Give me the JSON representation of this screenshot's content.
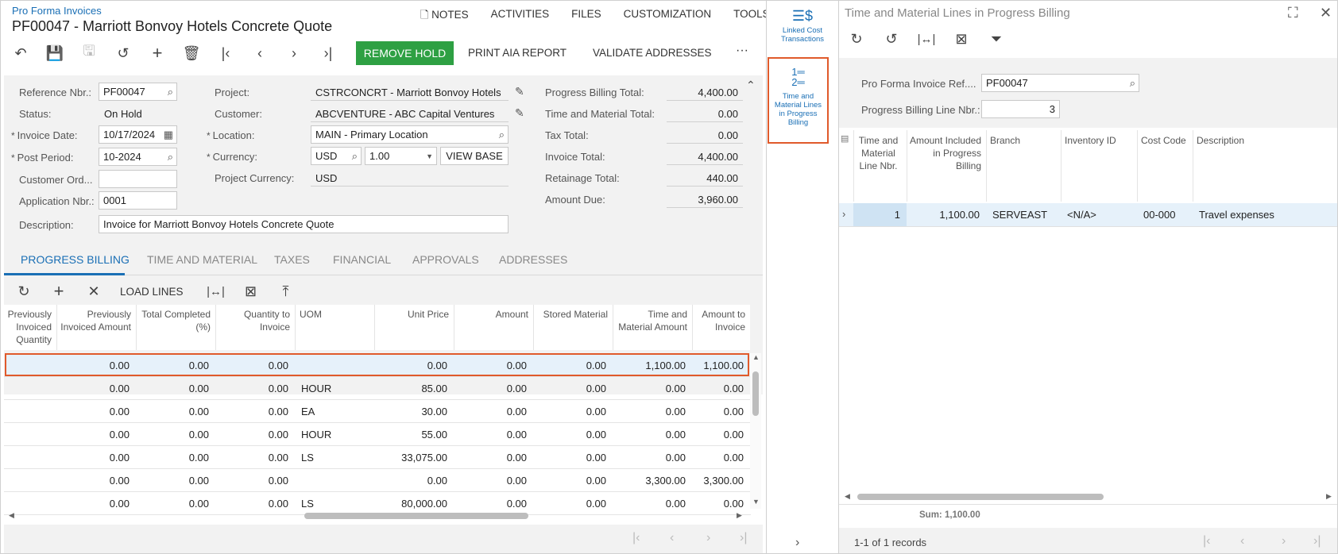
{
  "header": {
    "breadcrumb": "Pro Forma Invoices",
    "title": "PF00047 - Marriott Bonvoy Hotels Concrete Quote"
  },
  "top_menu": [
    "NOTES",
    "ACTIVITIES",
    "FILES",
    "CUSTOMIZATION",
    "TOOLS"
  ],
  "toolbar": {
    "remove_hold": "REMOVE HOLD",
    "print_aia": "PRINT AIA REPORT",
    "validate": "VALIDATE ADDRESSES",
    "more": "···"
  },
  "form": {
    "ref_label": "Reference Nbr.:",
    "ref_value": "PF00047",
    "status_label": "Status:",
    "status_value": "On Hold",
    "invdate_label": "Invoice Date:",
    "invdate_value": "10/17/2024",
    "postper_label": "Post Period:",
    "postper_value": "10-2024",
    "custord_label": "Customer Ord...",
    "custord_value": "",
    "appnbr_label": "Application Nbr.:",
    "appnbr_value": "0001",
    "desc_label": "Description:",
    "desc_value": "Invoice for Marriott Bonvoy Hotels Concrete Quote",
    "project_label": "Project:",
    "project_value": "CSTRCONCRT - Marriott Bonvoy Hotels",
    "customer_label": "Customer:",
    "customer_value": "ABCVENTURE - ABC Capital Ventures",
    "location_label": "Location:",
    "location_value": "MAIN - Primary Location",
    "currency_label": "Currency:",
    "currency_value": "USD",
    "rate_value": "1.00",
    "view_base": "VIEW BASE",
    "projcur_label": "Project Currency:",
    "projcur_value": "USD"
  },
  "totals": [
    {
      "label": "Progress Billing Total:",
      "value": "4,400.00"
    },
    {
      "label": "Time and Material Total:",
      "value": "0.00"
    },
    {
      "label": "Tax Total:",
      "value": "0.00"
    },
    {
      "label": "Invoice Total:",
      "value": "4,400.00"
    },
    {
      "label": "Retainage Total:",
      "value": "440.00"
    },
    {
      "label": "Amount Due:",
      "value": "3,960.00"
    }
  ],
  "tabs": [
    "PROGRESS BILLING",
    "TIME AND MATERIAL",
    "TAXES",
    "FINANCIAL",
    "APPROVALS",
    "ADDRESSES"
  ],
  "grid": {
    "load_lines": "LOAD LINES",
    "columns": [
      "Previously Invoiced Quantity",
      "Previously Invoiced Amount",
      "Total Completed (%)",
      "Quantity to Invoice",
      "UOM",
      "Unit Price",
      "Amount",
      "Stored Material",
      "Time and Material Amount",
      "Amount to Invoice"
    ],
    "rows": [
      [
        "",
        "0.00",
        "0.00",
        "0.00",
        "",
        "0.00",
        "0.00",
        "0.00",
        "1,100.00",
        "1,100.00"
      ],
      [
        "",
        "0.00",
        "0.00",
        "0.00",
        "HOUR",
        "85.00",
        "0.00",
        "0.00",
        "0.00",
        "0.00"
      ],
      [
        "",
        "0.00",
        "0.00",
        "0.00",
        "EA",
        "30.00",
        "0.00",
        "0.00",
        "0.00",
        "0.00"
      ],
      [
        "",
        "0.00",
        "0.00",
        "0.00",
        "HOUR",
        "55.00",
        "0.00",
        "0.00",
        "0.00",
        "0.00"
      ],
      [
        "",
        "0.00",
        "0.00",
        "0.00",
        "LS",
        "33,075.00",
        "0.00",
        "0.00",
        "0.00",
        "0.00"
      ],
      [
        "",
        "0.00",
        "0.00",
        "0.00",
        "",
        "0.00",
        "0.00",
        "0.00",
        "3,300.00",
        "3,300.00"
      ],
      [
        "",
        "0.00",
        "0.00",
        "0.00",
        "LS",
        "80,000.00",
        "0.00",
        "0.00",
        "0.00",
        "0.00"
      ]
    ]
  },
  "side_rail": {
    "linked": "Linked Cost Transactions",
    "tm_lines": "Time and Material Lines in Progress Billing"
  },
  "panel": {
    "title": "Time and Material Lines in Progress Billing",
    "ref_label": "Pro Forma Invoice Ref....",
    "ref_value": "PF00047",
    "line_label": "Progress Billing Line Nbr.:",
    "line_value": "3",
    "columns": [
      "Time and Material Line Nbr.",
      "Amount Included in Progress Billing",
      "Branch",
      "Inventory ID",
      "Cost Code",
      "Description"
    ],
    "row": [
      "1",
      "1,100.00",
      "SERVEAST",
      "<N/A>",
      "00-000",
      "Travel expenses"
    ],
    "sum": "Sum: 1,100.00",
    "records": "1-1 of 1 records"
  },
  "colors": {
    "accent": "#1a6fb5",
    "green": "#2ea043",
    "highlight": "#e05a2b"
  }
}
